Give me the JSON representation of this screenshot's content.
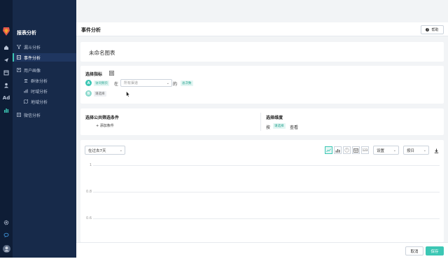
{
  "sidebar": {
    "title": "报表分析",
    "items": [
      {
        "label": "漏斗分析",
        "icon": "funnel-icon"
      },
      {
        "label": "事件分析",
        "icon": "event-icon"
      },
      {
        "label": "用户画像",
        "icon": "user-portrait-icon"
      },
      {
        "label": "群体分析",
        "icon": "group-icon"
      },
      {
        "label": "时域分析",
        "icon": "time-chart-icon"
      },
      {
        "label": "地域分析",
        "icon": "map-icon"
      },
      {
        "label": "微信分析",
        "icon": "wechat-icon"
      }
    ],
    "rail_ad": "Ad"
  },
  "header": {
    "title": "事件分析",
    "help_label": "帮助"
  },
  "chart_name": "未命名图表",
  "metrics": {
    "title": "选择指标",
    "row_a": {
      "badge": "A",
      "event_tag": "访问频页",
      "in_text": "在",
      "page_placeholder": "所有渠道",
      "of_text": "的",
      "measure_tag": "总次数"
    },
    "row_b": {
      "badge": "B",
      "select_tag": "请选择"
    }
  },
  "filters": {
    "title": "选择公共筛选条件",
    "add_label": "+ 添加条件"
  },
  "dimension": {
    "title": "选择维度",
    "by_text": "按",
    "select_tag": "请选择",
    "view_text": "查看"
  },
  "chart_toolbar": {
    "range_label": "在过去7天",
    "settings_label": "设置",
    "granularity_label": "按日",
    "number_button": "123"
  },
  "chart_data": {
    "type": "line",
    "ylim": [
      0.6,
      1
    ],
    "yticks": [
      "1",
      "0.8",
      "0.6"
    ],
    "series": []
  },
  "footer": {
    "cancel_label": "取消",
    "save_label": "保存"
  },
  "colors": {
    "accent": "#3cc7b4",
    "sidebar_bg": "#172a4a",
    "rail_bg": "#0e1d36"
  }
}
